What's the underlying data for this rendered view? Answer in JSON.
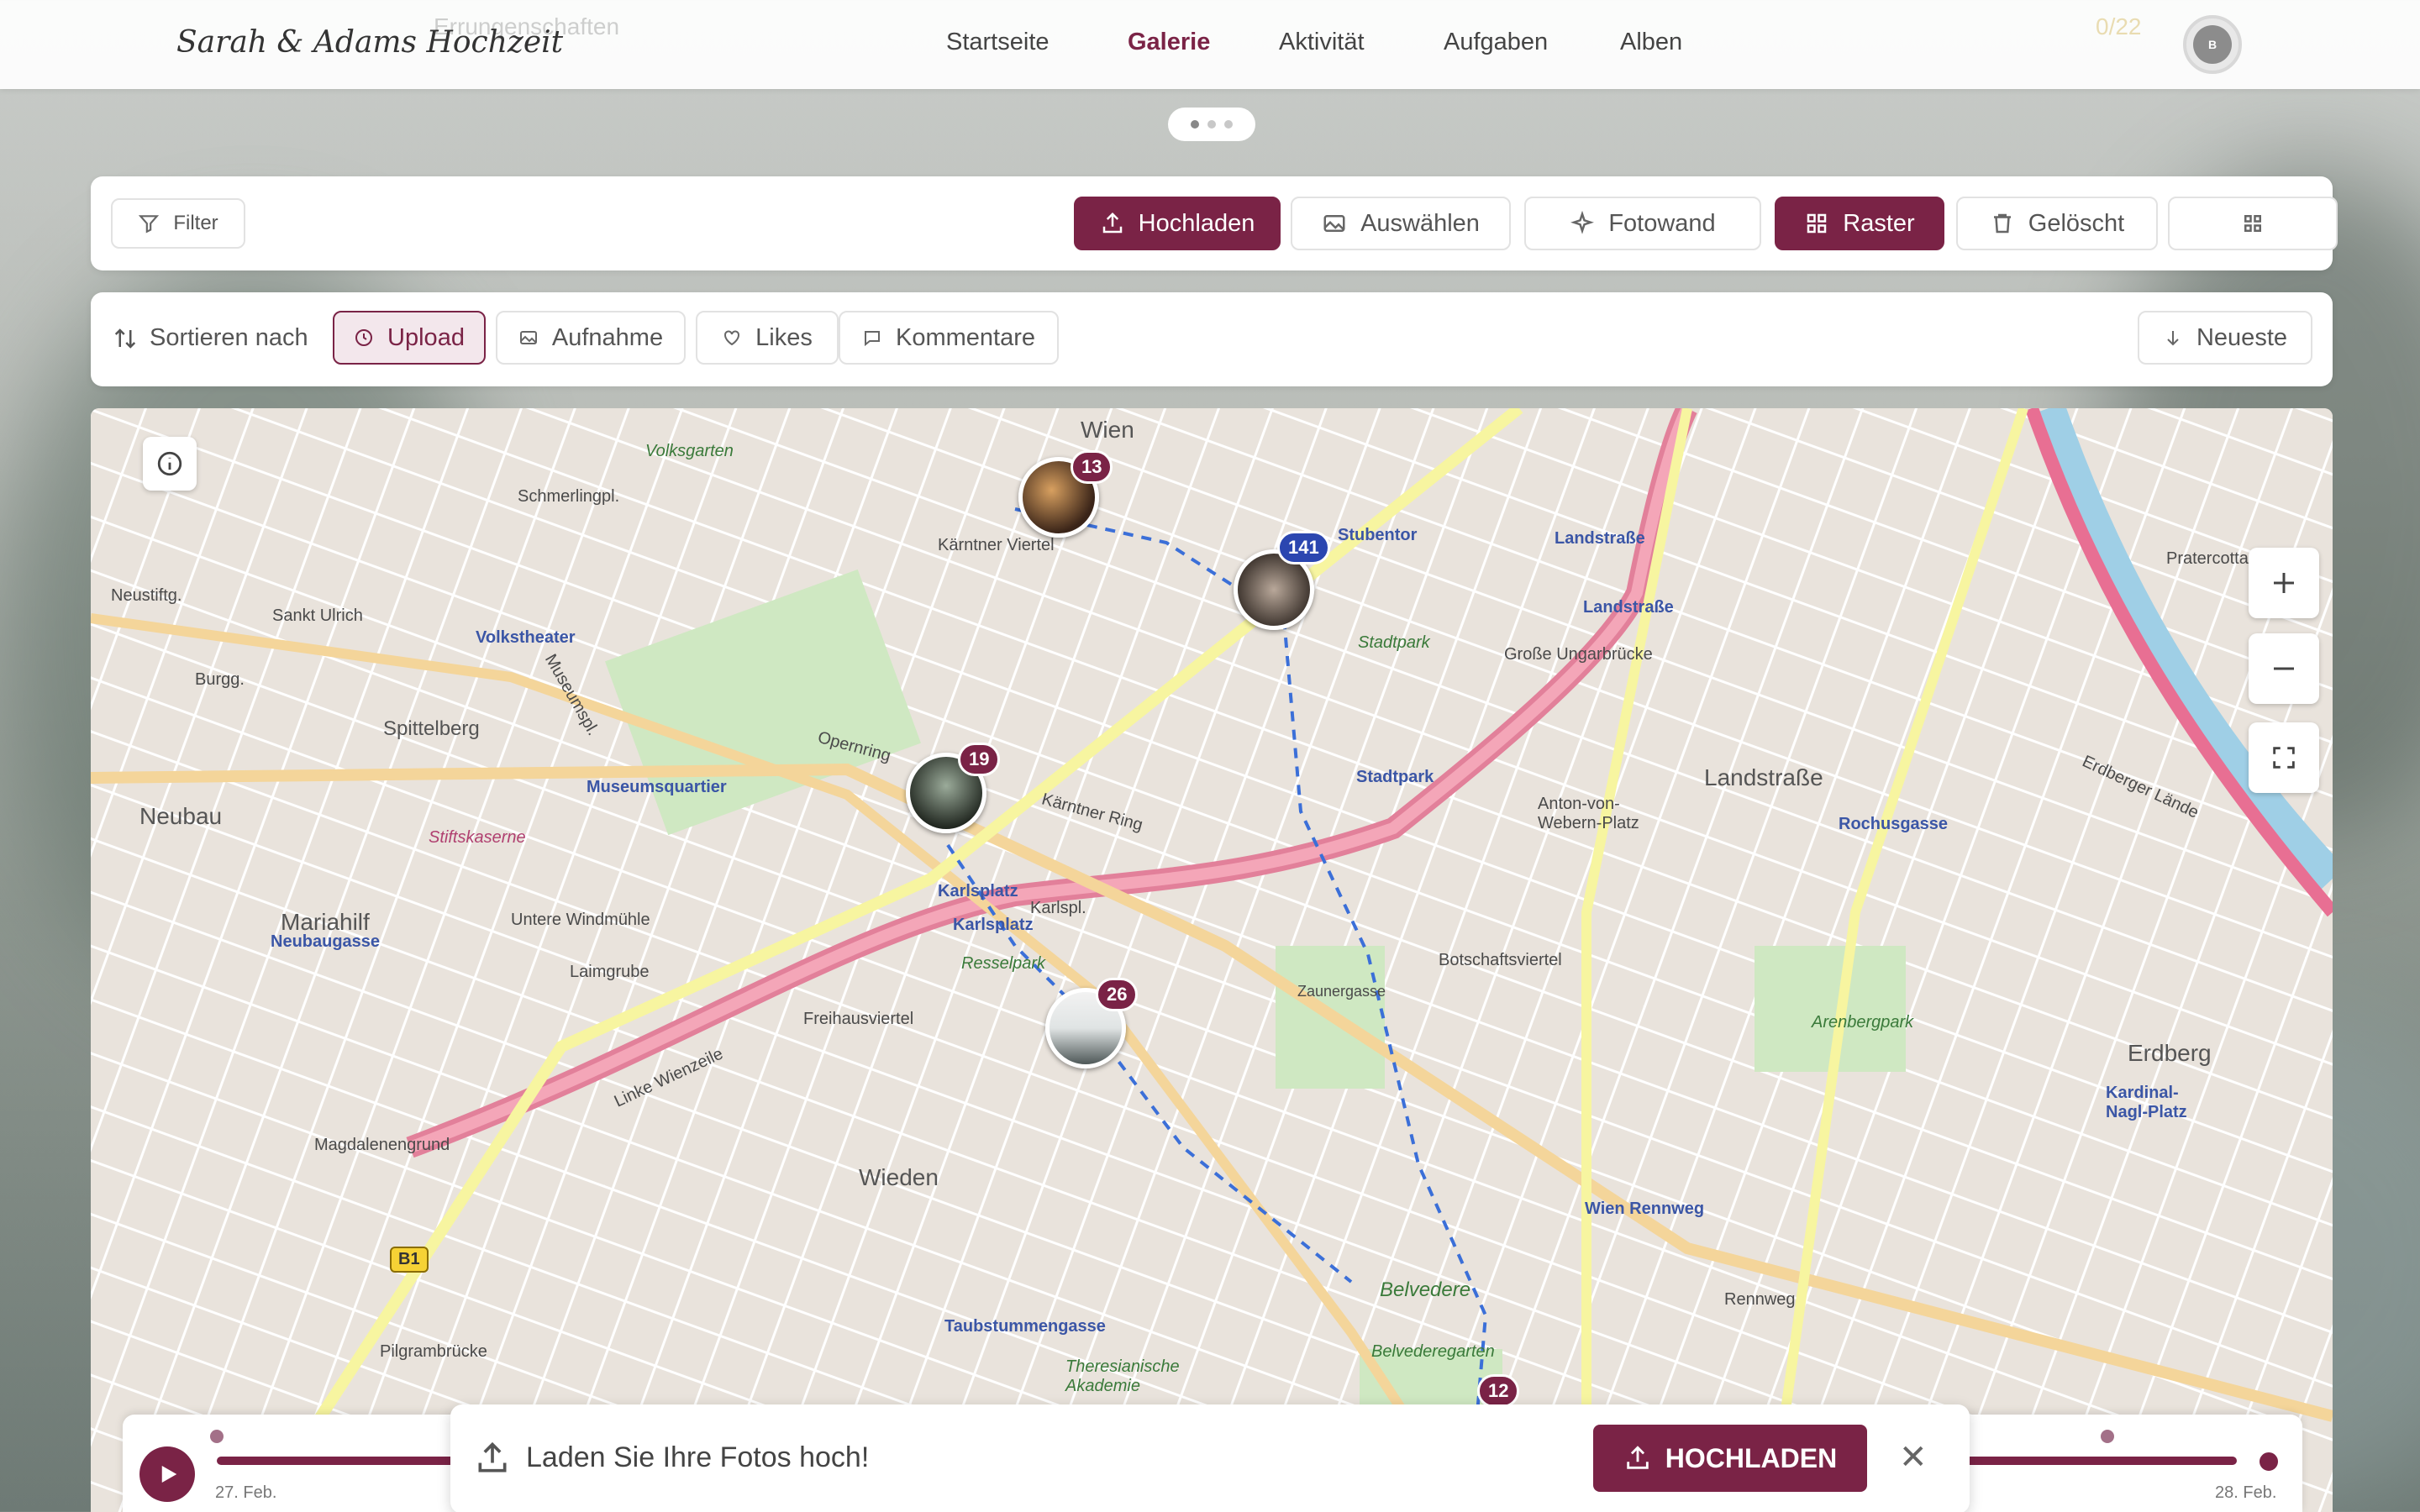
{
  "header": {
    "brand": "Sarah & Adams Hochzeit",
    "ghost_text": "Errungenschaften",
    "ghost_counter": "0/22",
    "avatar_initial": "B",
    "nav": [
      {
        "label": "Startseite",
        "active": false
      },
      {
        "label": "Galerie",
        "active": true
      },
      {
        "label": "Aktivität",
        "active": false
      },
      {
        "label": "Aufgaben",
        "active": false
      },
      {
        "label": "Alben",
        "active": false
      }
    ]
  },
  "toolbar": {
    "filter": "Filter",
    "upload": "Hochladen",
    "select": "Auswählen",
    "photowall": "Fotowand",
    "grid": "Raster",
    "deleted": "Gelöscht"
  },
  "sortbar": {
    "label": "Sortieren nach",
    "options": [
      "Upload",
      "Aufnahme",
      "Likes",
      "Kommentare"
    ],
    "selected": "Upload",
    "order": "Neueste"
  },
  "map": {
    "clusters": [
      {
        "count": "13",
        "color": "#7a2346"
      },
      {
        "count": "141",
        "color": "#2b46b0"
      },
      {
        "count": "19",
        "color": "#7a2346"
      },
      {
        "count": "26",
        "color": "#7a2346"
      },
      {
        "count": "12",
        "color": "#7a2346"
      }
    ],
    "labels": [
      "Wien",
      "Kärntner Viertel",
      "Stubentor",
      "Landstraße",
      "Landstraße",
      "Pratercottage",
      "Volksgarten",
      "Volkstheater",
      "Sankt Ulrich",
      "Neustiftg.",
      "Burgg.",
      "Spittelberg",
      "Neubau",
      "Museumsquartier",
      "Stiftskaserne",
      "Mariahilf",
      "Neubaugasse",
      "Untere Windmühle",
      "Laimgrube",
      "Karlsplatz",
      "Karlsplatz",
      "Karlspl.",
      "Resselpark",
      "Freihausviertel",
      "Wieden",
      "Stadtpark",
      "Stadtpark",
      "Große Ungarbrücke",
      "Anton-von-Webern-Platz",
      "Botschaftsviertel",
      "Zaunergasse",
      "Landstraße",
      "Rochusgasse",
      "Arenbergpark",
      "Erdberg",
      "Kardinal-Nagl-Platz",
      "Wien Rennweg",
      "Rennweg",
      "Belvedere",
      "Belvederegarten",
      "Taubstummengasse",
      "Theresianische Akademie",
      "Magdalenengrund",
      "Pilgrambrücke",
      "Linke Wienzeile",
      "Opernring",
      "Kärntner Ring",
      "Erdberger Lände",
      "Schmerlingpl.",
      "Museumspl."
    ],
    "road_badge": "B1"
  },
  "timeline": {
    "start_date": "27. Feb.",
    "end_date": "28. Feb."
  },
  "toast": {
    "message": "Laden Sie Ihre Fotos hoch!",
    "cta": "HOCHLADEN"
  },
  "colors": {
    "accent": "#7a2346",
    "cluster_blue": "#2b46b0"
  }
}
